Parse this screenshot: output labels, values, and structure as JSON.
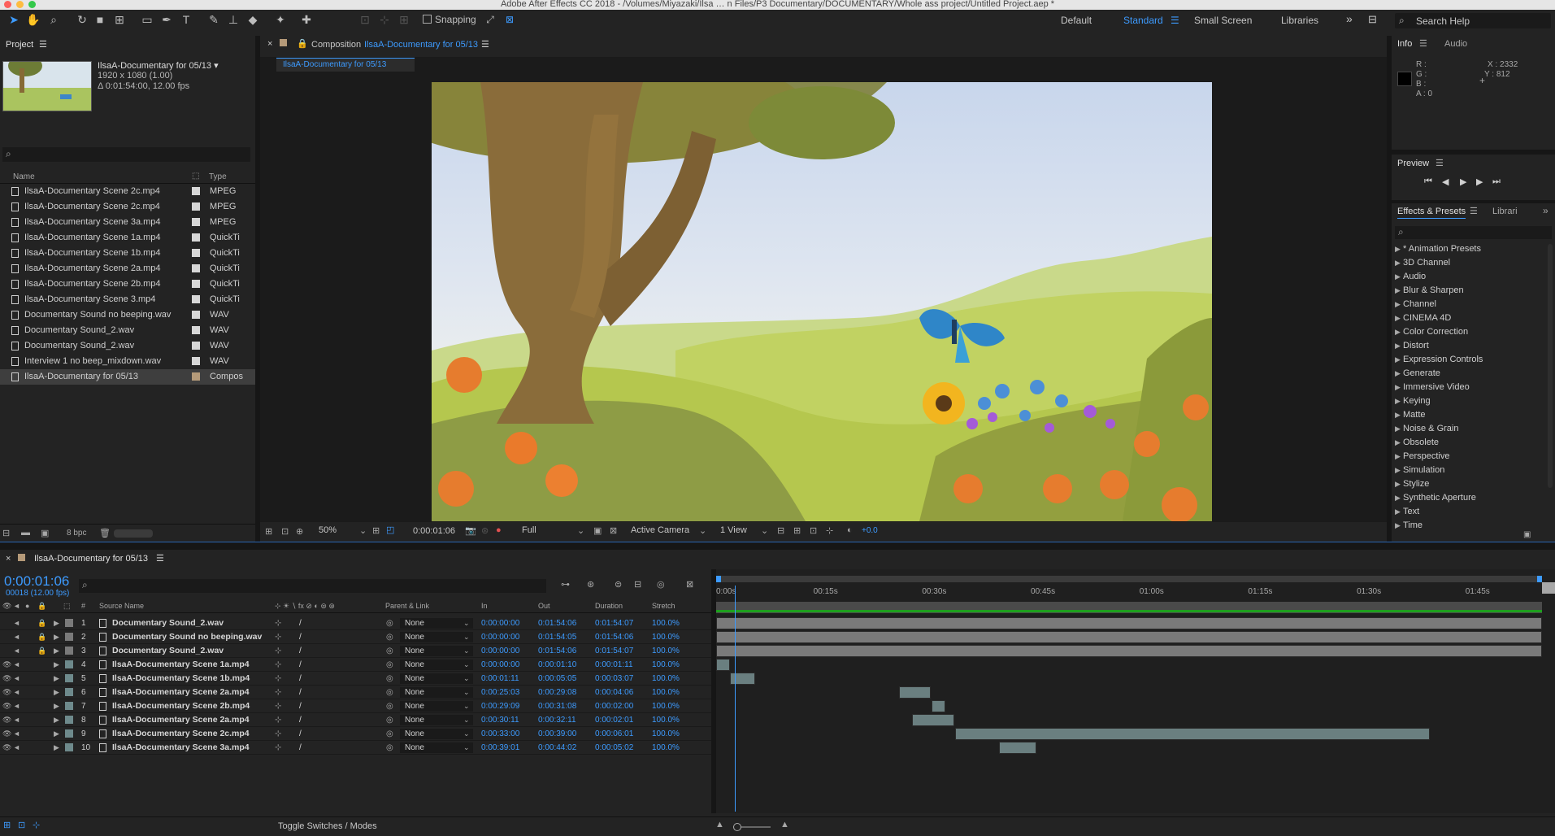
{
  "app": {
    "title": "Adobe After Effects CC 2018 - /Volumes/Miyazaki/Ilsa … n Files/P3 Documentary/DOCUMENTARY/Whole ass project/Untitled Project.aep *"
  },
  "toolbar": {
    "snapping_label": "Snapping",
    "workspaces": [
      "Default",
      "Standard",
      "Small Screen",
      "Libraries"
    ],
    "active_workspace": "Standard",
    "search_placeholder": "Search Help"
  },
  "project": {
    "title": "Project",
    "comp_name": "IlsaA-Documentary for 05/13 ▾",
    "comp_res": "1920 x 1080 (1.00)",
    "comp_dur": "Δ 0:01:54:00, 12.00 fps",
    "col_name": "Name",
    "col_type": "Type",
    "items": [
      {
        "name": "IlsaA-Documentary Scene 2c.mp4",
        "type": "MPEG",
        "color": "#d7d7d7"
      },
      {
        "name": "IlsaA-Documentary Scene 2c.mp4",
        "type": "MPEG",
        "color": "#d7d7d7"
      },
      {
        "name": "IlsaA-Documentary Scene 3a.mp4",
        "type": "MPEG",
        "color": "#d7d7d7"
      },
      {
        "name": "IlsaA-Documentary Scene 1a.mp4",
        "type": "QuickTi",
        "color": "#d7d7d7"
      },
      {
        "name": "IlsaA-Documentary Scene 1b.mp4",
        "type": "QuickTi",
        "color": "#d7d7d7"
      },
      {
        "name": "IlsaA-Documentary Scene 2a.mp4",
        "type": "QuickTi",
        "color": "#d7d7d7"
      },
      {
        "name": "IlsaA-Documentary Scene 2b.mp4",
        "type": "QuickTi",
        "color": "#d7d7d7"
      },
      {
        "name": "IlsaA-Documentary Scene 3.mp4",
        "type": "QuickTi",
        "color": "#d7d7d7"
      },
      {
        "name": "Documentary Sound no beeping.wav",
        "type": "WAV",
        "color": "#d7d7d7"
      },
      {
        "name": "Documentary Sound_2.wav",
        "type": "WAV",
        "color": "#d7d7d7"
      },
      {
        "name": "Documentary Sound_2.wav",
        "type": "WAV",
        "color": "#d7d7d7"
      },
      {
        "name": "Interview 1 no beep_mixdown.wav",
        "type": "WAV",
        "color": "#d7d7d7"
      },
      {
        "name": "IlsaA-Documentary for 05/13",
        "type": "Compos",
        "color": "#b59a79"
      }
    ],
    "bpc": "8 bpc"
  },
  "composition": {
    "panel_label": "Composition",
    "comp_link": "IlsaA-Documentary for 05/13",
    "tab": "IlsaA-Documentary for 05/13",
    "zoom": "50%",
    "timecode": "0:00:01:06",
    "resolution": "Full",
    "camera": "Active Camera",
    "views": "1 View",
    "exposure": "+0.0"
  },
  "info": {
    "tab_info": "Info",
    "tab_audio": "Audio",
    "r": "R :",
    "g": "G :",
    "b": "B :",
    "a": "A :  0",
    "x": "X : 2332",
    "y": "Y : 812"
  },
  "preview": {
    "title": "Preview"
  },
  "effects": {
    "title": "Effects & Presets",
    "tab2": "Librari",
    "items": [
      "* Animation Presets",
      "3D Channel",
      "Audio",
      "Blur & Sharpen",
      "Channel",
      "CINEMA 4D",
      "Color Correction",
      "Distort",
      "Expression Controls",
      "Generate",
      "Immersive Video",
      "Keying",
      "Matte",
      "Noise & Grain",
      "Obsolete",
      "Perspective",
      "Simulation",
      "Stylize",
      "Synthetic Aperture",
      "Text",
      "Time"
    ]
  },
  "timeline": {
    "tab": "IlsaA-Documentary for 05/13",
    "timecode": "0:00:01:06",
    "frames": "00018 (12.00 fps)",
    "cols": {
      "num": "#",
      "source": "Source Name",
      "parent": "Parent & Link",
      "in": "In",
      "out": "Out",
      "dur": "Duration",
      "stretch": "Stretch"
    },
    "ruler": [
      "0:00s",
      "00:15s",
      "00:30s",
      "00:45s",
      "01:00s",
      "01:15s",
      "01:30s",
      "01:45s"
    ],
    "layers": [
      {
        "n": "1",
        "name": "Documentary Sound_2.wav",
        "parent": "None",
        "in": "0:00:00:00",
        "out": "0:01:54:06",
        "dur": "0:01:54:07",
        "stretch": "100.0%",
        "start": 0,
        "end": 114,
        "video": false,
        "color": "#7a7a7a"
      },
      {
        "n": "2",
        "name": "Documentary Sound no beeping.wav",
        "parent": "None",
        "in": "0:00:00:00",
        "out": "0:01:54:05",
        "dur": "0:01:54:06",
        "stretch": "100.0%",
        "start": 0,
        "end": 114,
        "video": false,
        "color": "#7a7a7a"
      },
      {
        "n": "3",
        "name": "Documentary Sound_2.wav",
        "parent": "None",
        "in": "0:00:00:00",
        "out": "0:01:54:06",
        "dur": "0:01:54:07",
        "stretch": "100.0%",
        "start": 0,
        "end": 114,
        "video": false,
        "color": "#7a7a7a"
      },
      {
        "n": "4",
        "name": "IlsaA-Documentary Scene 1a.mp4",
        "parent": "None",
        "in": "0:00:00:00",
        "out": "0:00:01:10",
        "dur": "0:00:01:11",
        "stretch": "100.0%",
        "start": 0,
        "end": 1.9,
        "video": true,
        "color": "#6e8a8c"
      },
      {
        "n": "5",
        "name": "IlsaA-Documentary Scene 1b.mp4",
        "parent": "None",
        "in": "0:00:01:11",
        "out": "0:00:05:05",
        "dur": "0:00:03:07",
        "stretch": "100.0%",
        "start": 1.9,
        "end": 5.4,
        "video": true,
        "color": "#6e8a8c"
      },
      {
        "n": "6",
        "name": "IlsaA-Documentary Scene 2a.mp4",
        "parent": "None",
        "in": "0:00:25:03",
        "out": "0:00:29:08",
        "dur": "0:00:04:06",
        "stretch": "100.0%",
        "start": 25.2,
        "end": 29.6,
        "video": true,
        "color": "#6e8a8c"
      },
      {
        "n": "7",
        "name": "IlsaA-Documentary Scene 2b.mp4",
        "parent": "None",
        "in": "0:00:29:09",
        "out": "0:00:31:08",
        "dur": "0:00:02:00",
        "stretch": "100.0%",
        "start": 29.7,
        "end": 31.6,
        "video": true,
        "color": "#6e8a8c"
      },
      {
        "n": "8",
        "name": "IlsaA-Documentary Scene 2a.mp4",
        "parent": "None",
        "in": "0:00:30:11",
        "out": "0:00:32:11",
        "dur": "0:00:02:01",
        "stretch": "100.0%",
        "start": 27,
        "end": 32.9,
        "video": true,
        "color": "#6e8a8c"
      },
      {
        "n": "9",
        "name": "IlsaA-Documentary Scene 2c.mp4",
        "parent": "None",
        "in": "0:00:33:00",
        "out": "0:00:39:00",
        "dur": "0:00:06:01",
        "stretch": "100.0%",
        "start": 33,
        "end": 98.5,
        "video": true,
        "color": "#6e8a8c"
      },
      {
        "n": "10",
        "name": "IlsaA-Documentary Scene 3a.mp4",
        "parent": "None",
        "in": "0:00:39:01",
        "out": "0:00:44:02",
        "dur": "0:00:05:02",
        "stretch": "100.0%",
        "start": 39.1,
        "end": 44.2,
        "video": true,
        "color": "#6e8a8c"
      }
    ],
    "toggle": "Toggle Switches / Modes"
  }
}
